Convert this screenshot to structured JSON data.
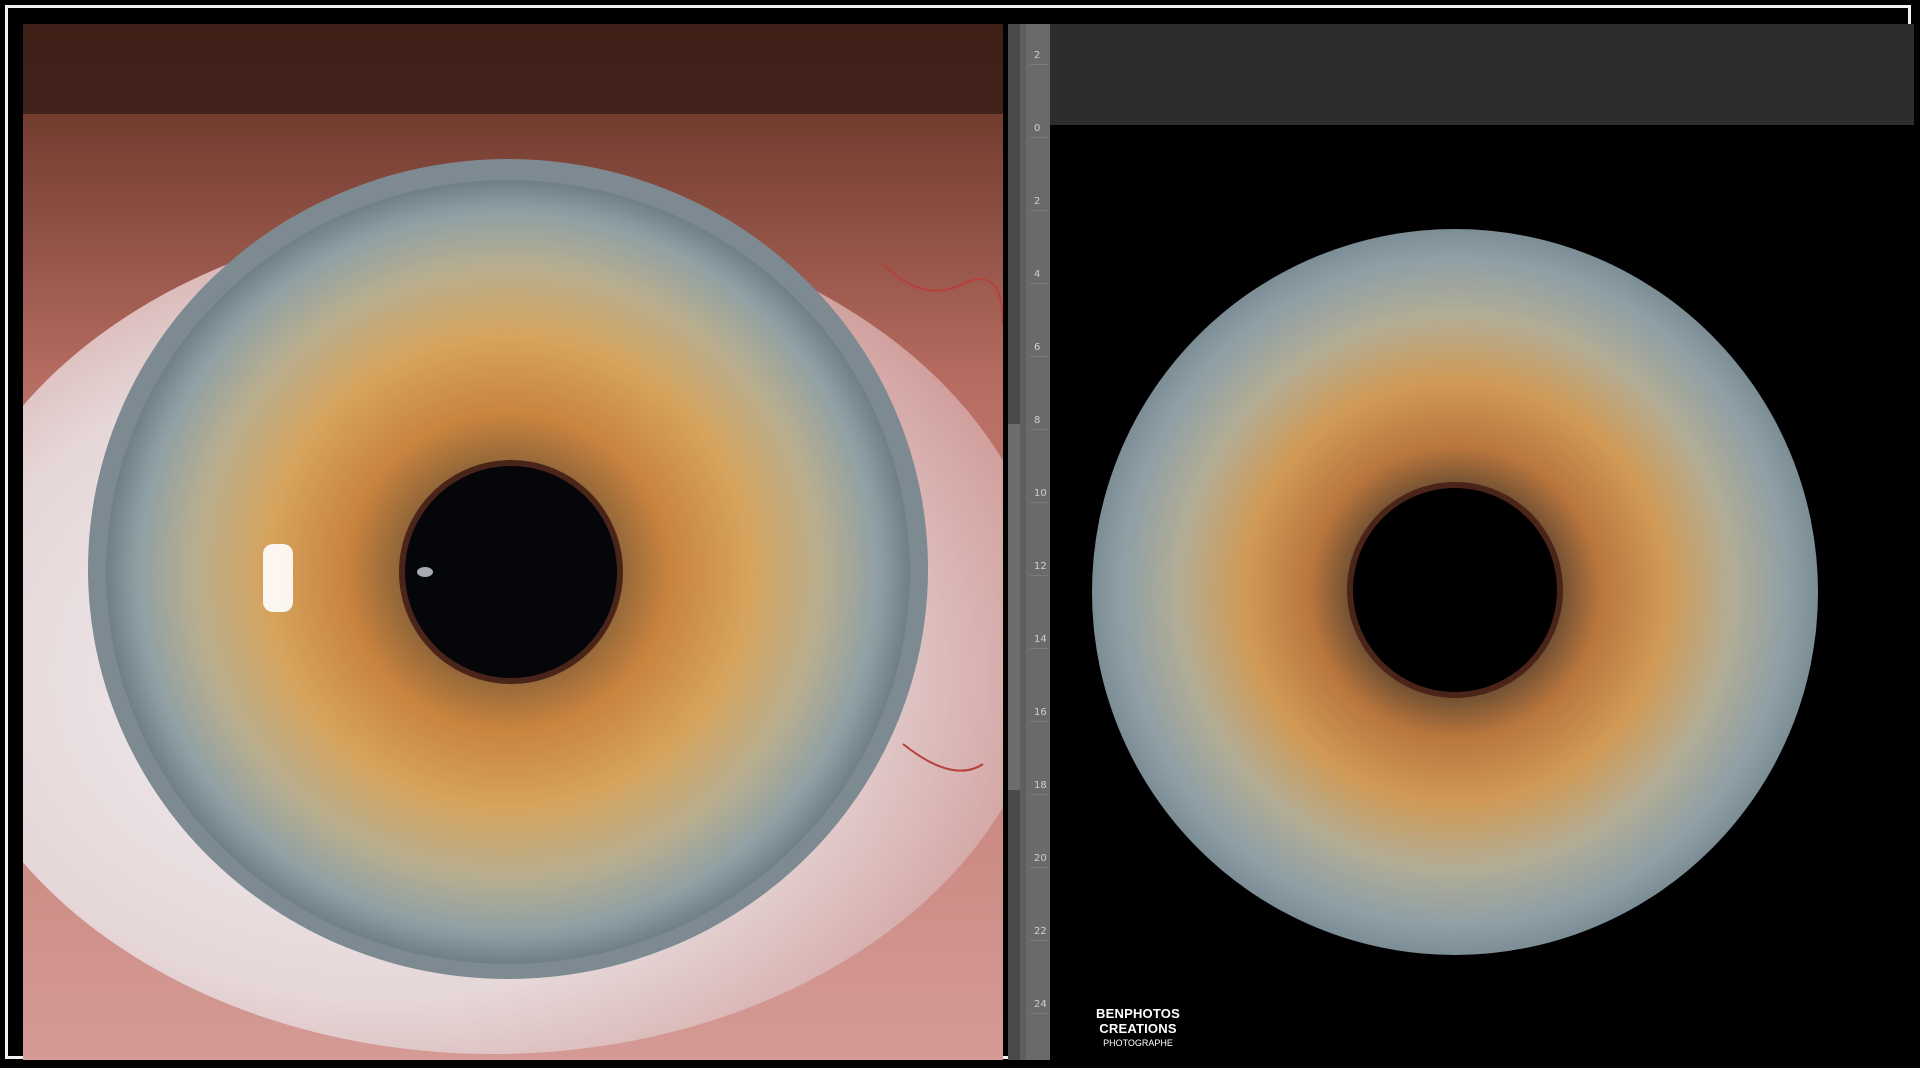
{
  "watermark": {
    "title": "BENPHOTOS CREATIONS",
    "subtitle": "PHOTOGRAPHE"
  },
  "ruler": {
    "labels": [
      "2",
      "0",
      "2",
      "4",
      "6",
      "8",
      "10",
      "12",
      "14",
      "16",
      "18",
      "20",
      "22",
      "24"
    ]
  },
  "colors": {
    "frame_border": "#f2f2f2",
    "background": "#000000",
    "toolbar": "#2d2d2d",
    "ruler": "#6a6a6a",
    "iris_orange": "#c9833f",
    "iris_blue_gray": "#8fa0a5",
    "pupil": "#05060a",
    "skin": "#c98a86"
  }
}
